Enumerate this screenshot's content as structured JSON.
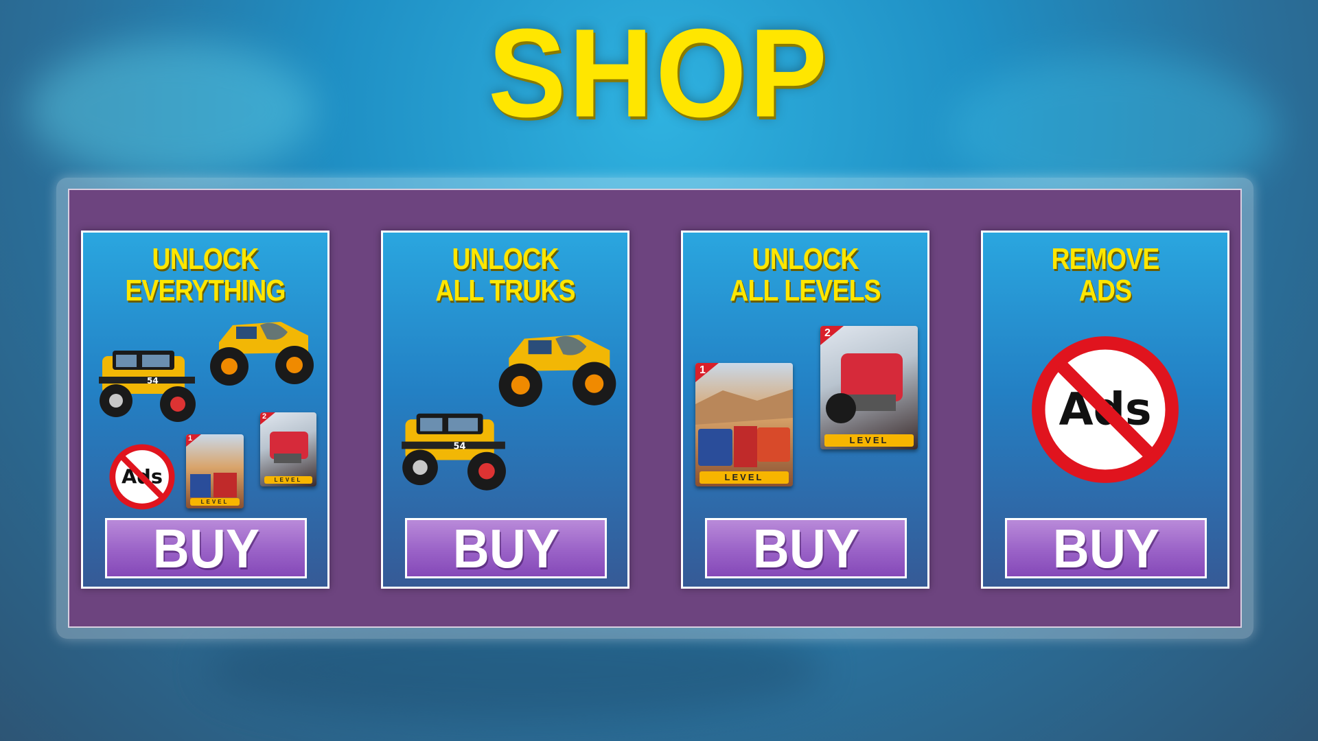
{
  "title": "SHOP",
  "cards": [
    {
      "title_line1": "UNLOCK",
      "title_line2": "EVERYTHING",
      "button": "BUY"
    },
    {
      "title_line1": "UNLOCK",
      "title_line2": "ALL TRUKS",
      "button": "BUY"
    },
    {
      "title_line1": "UNLOCK",
      "title_line2": "ALL LEVELS",
      "button": "BUY"
    },
    {
      "title_line1": "REMOVE",
      "title_line2": "ADS",
      "button": "BUY"
    }
  ],
  "badges": {
    "ads_text": "Ads",
    "level_label": "LEVEL",
    "level_1": "1",
    "level_2": "2"
  },
  "colors": {
    "title": "#ffe600",
    "panel": "#6d447f",
    "button": "#9a62c7",
    "card_top": "#2aa6df",
    "card_bottom": "#365a96"
  }
}
